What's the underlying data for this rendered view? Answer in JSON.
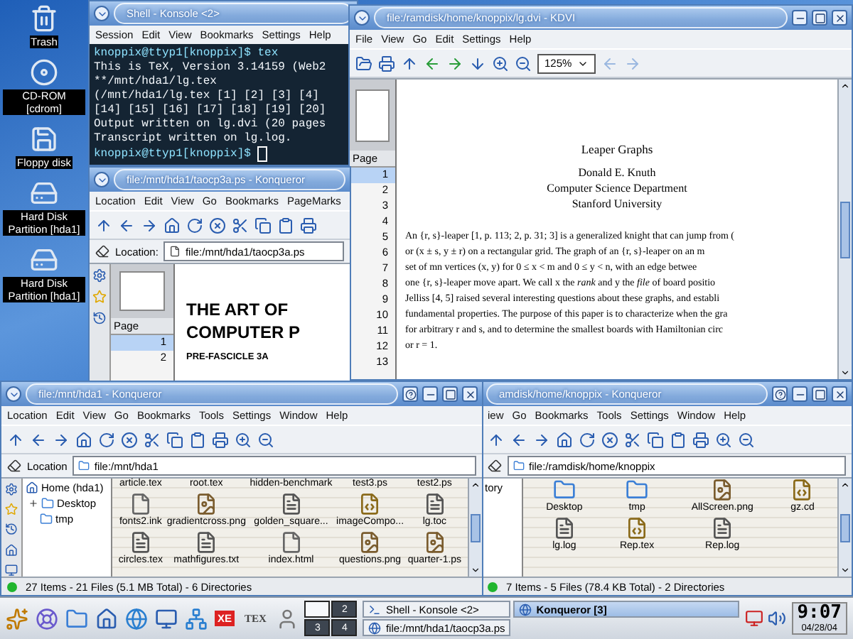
{
  "desktop_icons": [
    {
      "label": "Trash",
      "kind": "trash"
    },
    {
      "label": "CD-ROM [cdrom]",
      "kind": "cdrom"
    },
    {
      "label": "Floppy disk",
      "kind": "floppy"
    },
    {
      "label": "Hard Disk Partition [hda1]",
      "kind": "disk"
    },
    {
      "label": "Hard Disk Partition [hda1]",
      "kind": "disk"
    }
  ],
  "windows": [
    {
      "kind": "terminal",
      "title": "Shell - Konsole <2>",
      "menu": [
        "Session",
        "Edit",
        "View",
        "Bookmarks",
        "Settings",
        "Help"
      ],
      "lines": [
        {
          "kind": "prompt",
          "text": "knoppix@ttyp1[knoppix]$ tex"
        },
        {
          "kind": "output",
          "text": "This is TeX, Version 3.14159 (Web2"
        },
        {
          "kind": "output",
          "text": "**/mnt/hda1/lg.tex"
        },
        {
          "kind": "output",
          "text": "(/mnt/hda1/lg.tex [1] [2] [3] [4]"
        },
        {
          "kind": "output",
          "text": "[14] [15] [16] [17] [18] [19] [20]"
        },
        {
          "kind": "output",
          "text": "Output written on lg.dvi (20 pages"
        },
        {
          "kind": "output",
          "text": "Transcript written on lg.log."
        },
        {
          "kind": "prompt",
          "text": "knoppix@ttyp1[knoppix]$ "
        }
      ]
    },
    {
      "kind": "dvi",
      "title": "file:/ramdisk/home/knoppix/lg.dvi - KDVI",
      "menu": [
        "File",
        "View",
        "Go",
        "Edit",
        "Settings",
        "Help"
      ],
      "zoom": "125%",
      "page_header": "Page",
      "pages": [
        {
          "label": "1",
          "selected": true
        },
        {
          "label": "2",
          "selected": false
        },
        {
          "label": "3",
          "selected": false
        },
        {
          "label": "4",
          "selected": false
        },
        {
          "label": "5",
          "selected": false
        },
        {
          "label": "6",
          "selected": false
        },
        {
          "label": "7",
          "selected": false
        },
        {
          "label": "8",
          "selected": false
        },
        {
          "label": "9",
          "selected": false
        },
        {
          "label": "10",
          "selected": false
        },
        {
          "label": "11",
          "selected": false
        },
        {
          "label": "12",
          "selected": false
        },
        {
          "label": "13",
          "selected": false
        }
      ],
      "document": {
        "title": "Leaper Graphs",
        "authors": [
          "Donald E. Knuth",
          "Computer Science Department",
          "Stanford University"
        ],
        "lines": [
          "An {r, s}-leaper [1, p. 113; 2, p. 31; 3] is a generalized knight that can jump from (",
          "or (x ± s, y ± r) on a rectangular grid. The graph of an {r, s}-leaper on an m",
          "set of mn vertices (x, y) for 0 ≤ x < m and 0 ≤ y < n, with an edge betwee",
          "one {r, s}-leaper move apart. We call x the *rank* and y the *file* of board positio",
          "Jelliss [4, 5] raised several interesting questions about these graphs, and establi",
          "fundamental properties. The purpose of this paper is to characterize when the gra",
          "for arbitrary r and s, and to determine the smallest boards with Hamiltonian circ",
          "or r = 1."
        ]
      }
    },
    {
      "kind": "postscript",
      "title": "file:/mnt/hda1/taocp3a.ps - Konqueror",
      "menu": [
        "Location",
        "Edit",
        "View",
        "Go",
        "Bookmarks",
        "PageMarks"
      ],
      "location_label": "Location:",
      "location": "file:/mnt/hda1/taocp3a.ps",
      "page_header": "Page",
      "pages": [
        {
          "label": "1",
          "selected": true
        },
        {
          "label": "2",
          "selected": false
        }
      ],
      "document": {
        "heading": [
          "THE ART OF",
          "COMPUTER P"
        ],
        "subheading": "PRE-FASCICLE 3A"
      }
    },
    {
      "kind": "files",
      "title": "file:/mnt/hda1 - Konqueror",
      "menu": [
        "Location",
        "Edit",
        "View",
        "Go",
        "Bookmarks",
        "Tools",
        "Settings",
        "Window",
        "Help"
      ],
      "location_label": "Location",
      "location": "file:/mnt/hda1",
      "tree": [
        {
          "label": "Home (hda1)",
          "children": [
            {
              "label": "Desktop",
              "expanded": false
            },
            {
              "label": "tmp"
            }
          ]
        }
      ],
      "files": [
        {
          "kind": "partial",
          "label": "article.tex"
        },
        {
          "kind": "partial",
          "label": "root.tex"
        },
        {
          "kind": "partial",
          "label": "hidden-benchmark"
        },
        {
          "kind": "partial",
          "label": "test3.ps"
        },
        {
          "kind": "partial",
          "label": "test2.ps"
        },
        {
          "kind": "doc",
          "label": "fonts2.ink"
        },
        {
          "kind": "image",
          "label": "gradientcross.png"
        },
        {
          "kind": "text",
          "label": "golden_square..."
        },
        {
          "kind": "script",
          "label": "imageCompo..."
        },
        {
          "kind": "text",
          "label": "lg.toc"
        },
        {
          "kind": "text",
          "label": "circles.tex"
        },
        {
          "kind": "text",
          "label": "mathfigures.txt"
        },
        {
          "kind": "doc",
          "label": "index.html"
        },
        {
          "kind": "image",
          "label": "questions.png"
        },
        {
          "kind": "image",
          "label": "quarter-1.ps"
        }
      ],
      "status": "27 Items - 21 Files (5.1 MB Total) - 6 Directories"
    },
    {
      "kind": "files",
      "title": "amdisk/home/knoppix - Konqueror",
      "menu": [
        "iew",
        "Go",
        "Bookmarks",
        "Tools",
        "Settings",
        "Window",
        "Help"
      ],
      "location": "file:/ramdisk/home/knoppix",
      "sidebar_label": "tory",
      "files": [
        {
          "kind": "folder",
          "label": "Desktop"
        },
        {
          "kind": "folder",
          "label": "tmp"
        },
        {
          "kind": "image",
          "label": "AllScreen.png"
        },
        {
          "kind": "script",
          "label": "gz.cd"
        },
        {
          "kind": "text",
          "label": "lg.log"
        },
        {
          "kind": "script",
          "label": "Rep.tex"
        },
        {
          "kind": "text",
          "label": "Rep.log"
        }
      ],
      "status": "7 Items - 5 Files (78.4 KB Total) - 2 Directories"
    }
  ],
  "taskbar": {
    "launchers": [
      {
        "kind": "kmenu"
      },
      {
        "kind": "help"
      },
      {
        "kind": "folder"
      },
      {
        "kind": "home"
      },
      {
        "kind": "globe"
      },
      {
        "kind": "monitor"
      },
      {
        "kind": "network"
      },
      {
        "kind": "badge",
        "label": "XE"
      },
      {
        "kind": "logo",
        "label": "TEX"
      },
      {
        "kind": "person"
      }
    ],
    "pager": [
      {
        "selected": true
      },
      {
        "label": "2",
        "selected": false
      },
      {
        "label": "3",
        "selected": false
      },
      {
        "label": "4",
        "selected": false
      }
    ],
    "tasks": [
      {
        "label": "Shell - Konsole <2>",
        "selected": false
      },
      {
        "label": "file:/mnt/hda1/taocp3a.ps",
        "selected": false
      },
      {
        "label": "Konqueror [3]",
        "selected": true
      }
    ],
    "clock": "9:07",
    "date": "04/28/04"
  }
}
